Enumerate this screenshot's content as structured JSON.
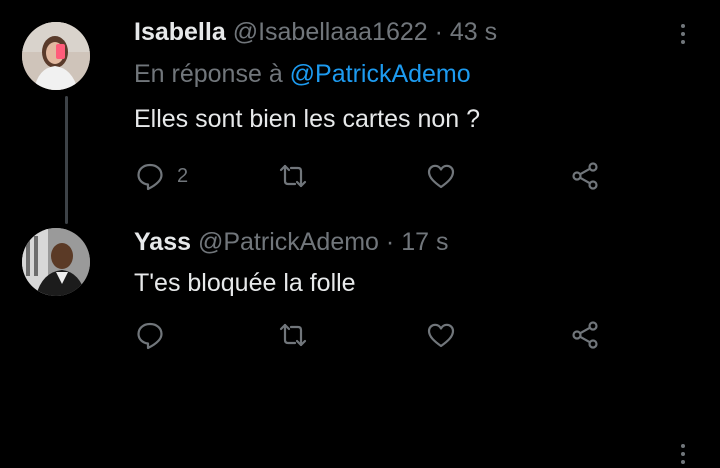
{
  "tweets": [
    {
      "name": "Isabella",
      "handle": "@Isabellaaa1622",
      "separator": "·",
      "time": "43 s",
      "reply_prefix": "En réponse à",
      "reply_mention": "@PatrickAdemo",
      "text": "Elles sont bien les cartes non ?",
      "reply_count": "2",
      "icons": [
        "reply-icon",
        "retweet-icon",
        "like-icon",
        "share-icon",
        "more-icon"
      ]
    },
    {
      "name": "Yass",
      "handle": "@PatrickAdemo",
      "separator": "·",
      "time": "17 s",
      "text": "T'es bloquée la folle",
      "icons": [
        "reply-icon",
        "retweet-icon",
        "like-icon",
        "share-icon",
        "more-icon"
      ]
    }
  ],
  "colors": {
    "background": "#000000",
    "text": "#e7e9ea",
    "secondary": "#71767b",
    "accent": "#1d9bf0",
    "thread_line": "#3d4247"
  }
}
